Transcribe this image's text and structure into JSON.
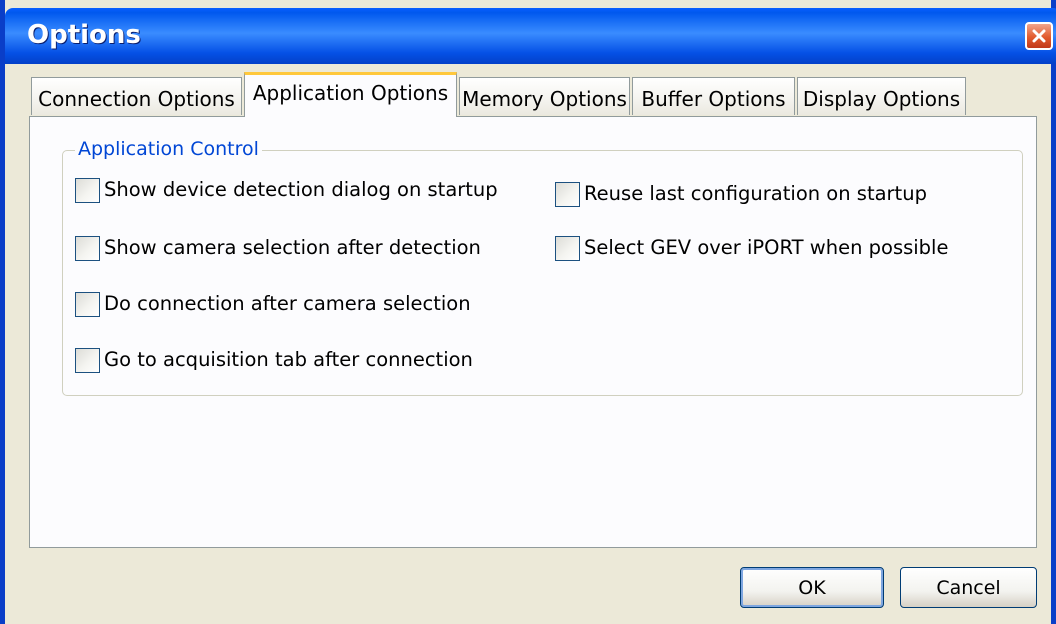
{
  "window": {
    "title": "Options"
  },
  "tabs": [
    {
      "label": "Connection Options",
      "active": false
    },
    {
      "label": "Application Options",
      "active": true
    },
    {
      "label": "Memory Options",
      "active": false
    },
    {
      "label": "Buffer Options",
      "active": false
    },
    {
      "label": "Display Options",
      "active": false
    }
  ],
  "group": {
    "label": "Application Control",
    "left_column": [
      {
        "label": "Show device detection dialog on startup",
        "checked": false
      },
      {
        "label": "Show camera selection after detection",
        "checked": false
      },
      {
        "label": "Do connection after camera selection",
        "checked": false
      },
      {
        "label": "Go to acquisition tab after connection",
        "checked": false
      }
    ],
    "right_column": [
      {
        "label": "Reuse last configuration on startup",
        "checked": false
      },
      {
        "label": "Select GEV over iPORT when possible",
        "checked": false
      }
    ]
  },
  "buttons": {
    "ok": "OK",
    "cancel": "Cancel"
  },
  "colors": {
    "titlebar": "#0058ee",
    "dialog_bg": "#ece9d8",
    "group_label": "#0046d5",
    "active_tab_accent": "#ffc83c"
  }
}
